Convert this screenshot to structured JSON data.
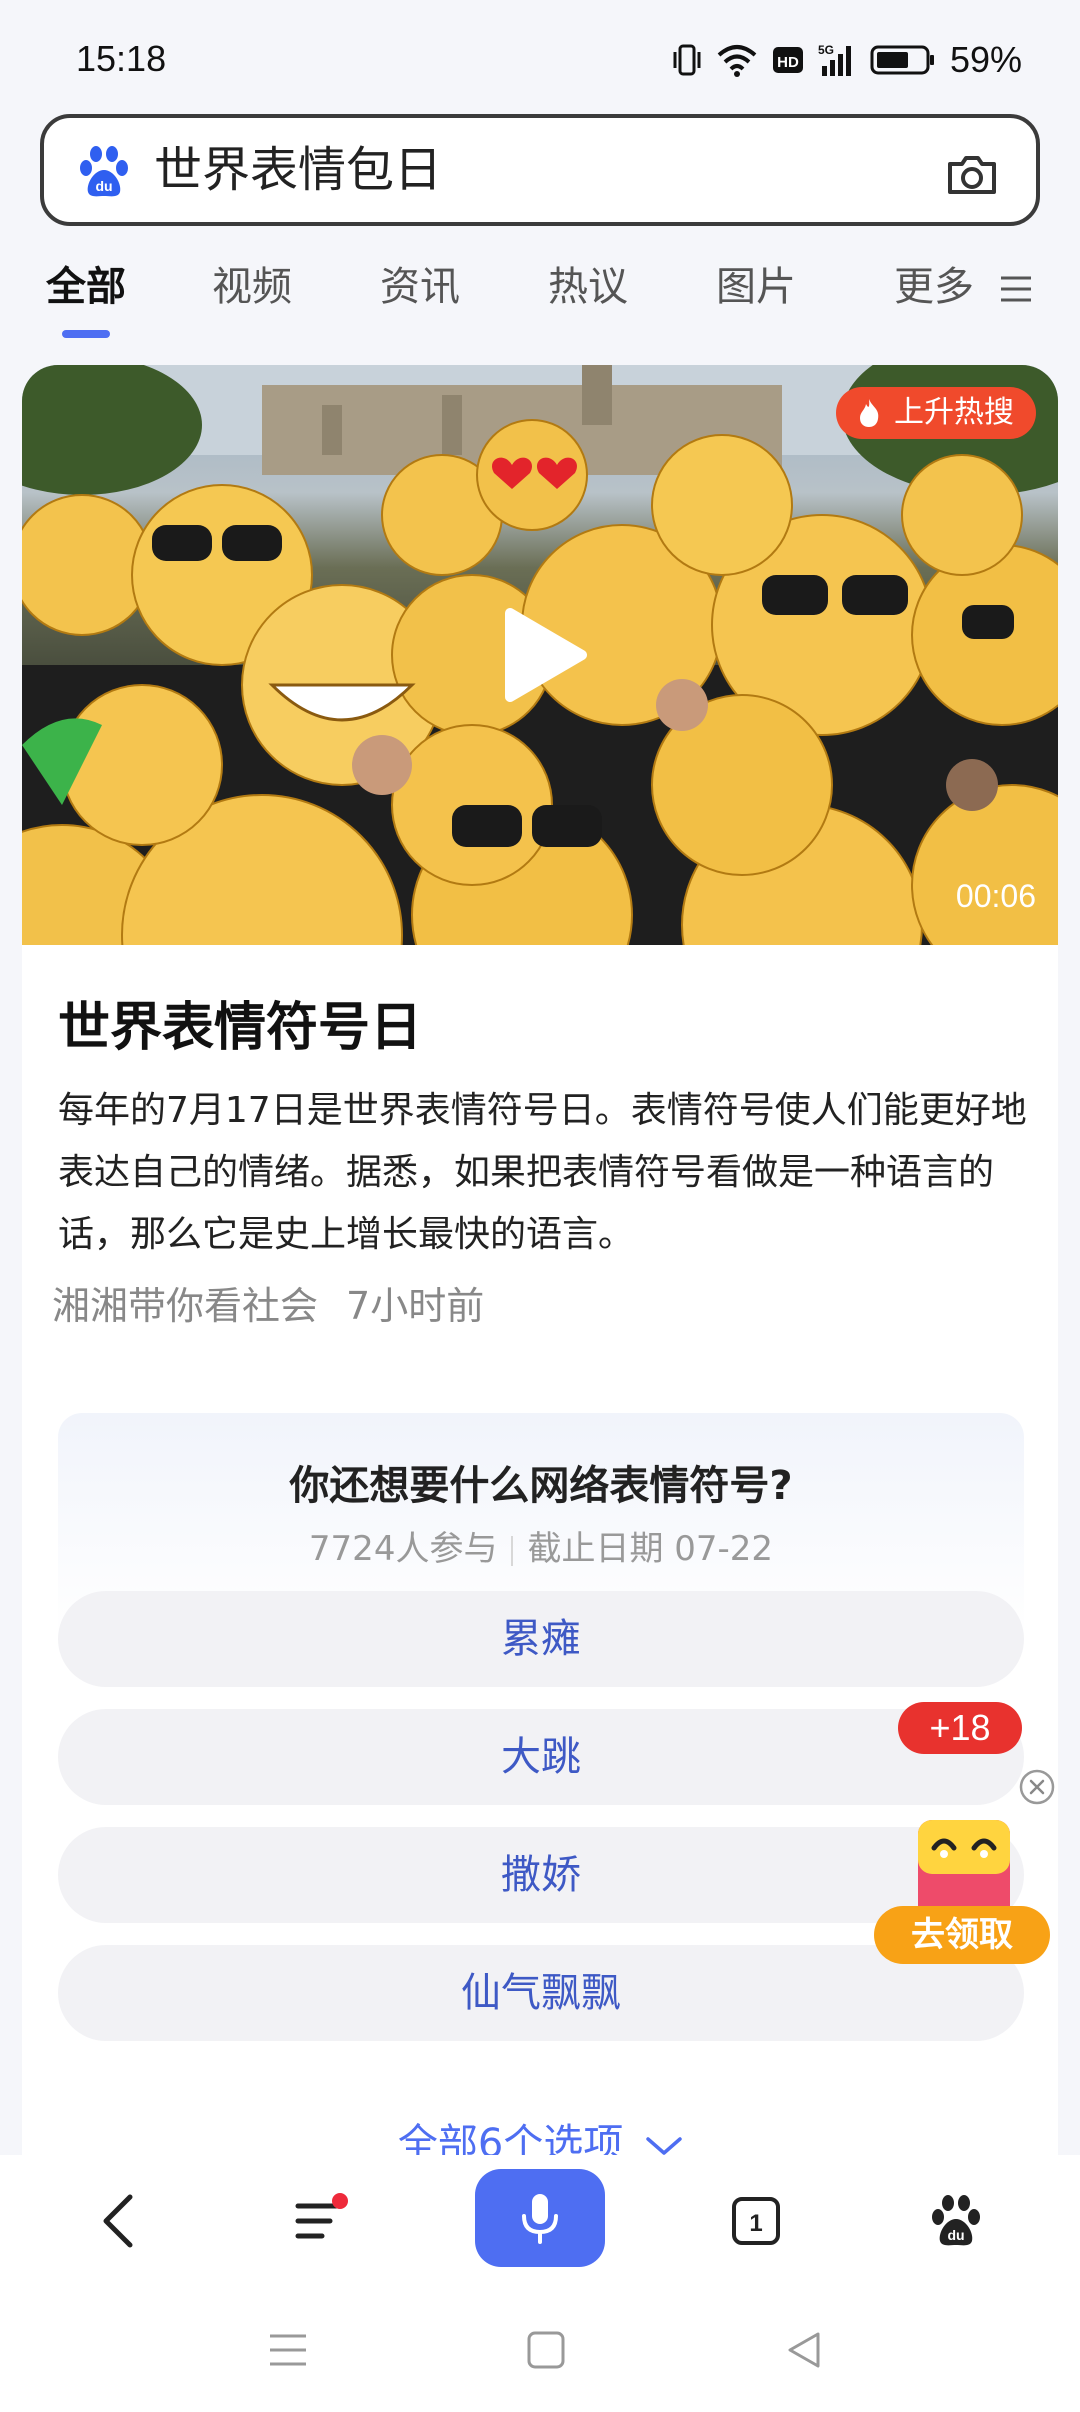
{
  "status_bar": {
    "time": "15:18",
    "battery": "59%",
    "icons": [
      "vibrate-icon",
      "wifi-icon",
      "hd-icon",
      "5g-signal-icon",
      "battery-icon"
    ]
  },
  "search": {
    "query": "世界表情包日",
    "logo_icon": "baidu-paw-icon",
    "camera_icon": "camera-icon"
  },
  "tabs": [
    {
      "label": "全部",
      "active": true
    },
    {
      "label": "视频",
      "active": false
    },
    {
      "label": "资讯",
      "active": false
    },
    {
      "label": "热议",
      "active": false
    },
    {
      "label": "图片",
      "active": false
    },
    {
      "label": "更多",
      "active": false
    }
  ],
  "video": {
    "badge": "上升热搜",
    "duration": "00:06"
  },
  "article": {
    "title": "世界表情符号日",
    "body": "每年的7月17日是世界表情符号日。表情符号使人们能更好地表达自己的情绪。据悉，如果把表情符号看做是一种语言的话，那么它是史上增长最快的语言。",
    "source": "湘湘带你看社会",
    "time": "7小时前"
  },
  "poll": {
    "question": "你还想要什么网络表情符号?",
    "participants": "7724人参与",
    "deadline": "截止日期 07-22",
    "options": [
      "累瘫",
      "大跳",
      "撒娇",
      "仙气飘飘"
    ],
    "more": "全部6个选项"
  },
  "reward": {
    "bubble": "+18",
    "button": "去领取"
  },
  "colors": {
    "accent": "#4e6ef2",
    "hot": "#f04a2c",
    "reward_orange": "#f8a216"
  }
}
